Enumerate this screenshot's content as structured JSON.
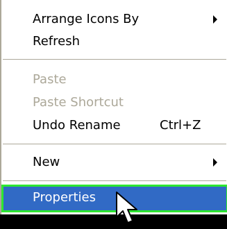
{
  "menu": {
    "items": [
      {
        "label": "Arrange Icons By",
        "submenu": true,
        "enabled": true
      },
      {
        "label": "Refresh",
        "enabled": true
      },
      {
        "label": "Paste",
        "enabled": false
      },
      {
        "label": "Paste Shortcut",
        "enabled": false
      },
      {
        "label": "Undo Rename",
        "shortcut": "Ctrl+Z",
        "enabled": true
      },
      {
        "label": "New",
        "submenu": true,
        "enabled": true
      },
      {
        "label": "Properties",
        "enabled": true,
        "highlighted": true
      }
    ]
  },
  "colors": {
    "highlight_bg": "#316ac5",
    "highlight_outline": "#2ee830",
    "disabled_text": "#aca899",
    "separator": "#aca899",
    "background_below": "#000000"
  },
  "icons": {
    "cursor": "arrow-cursor-icon",
    "submenu_arrow": "submenu-arrow-icon"
  }
}
